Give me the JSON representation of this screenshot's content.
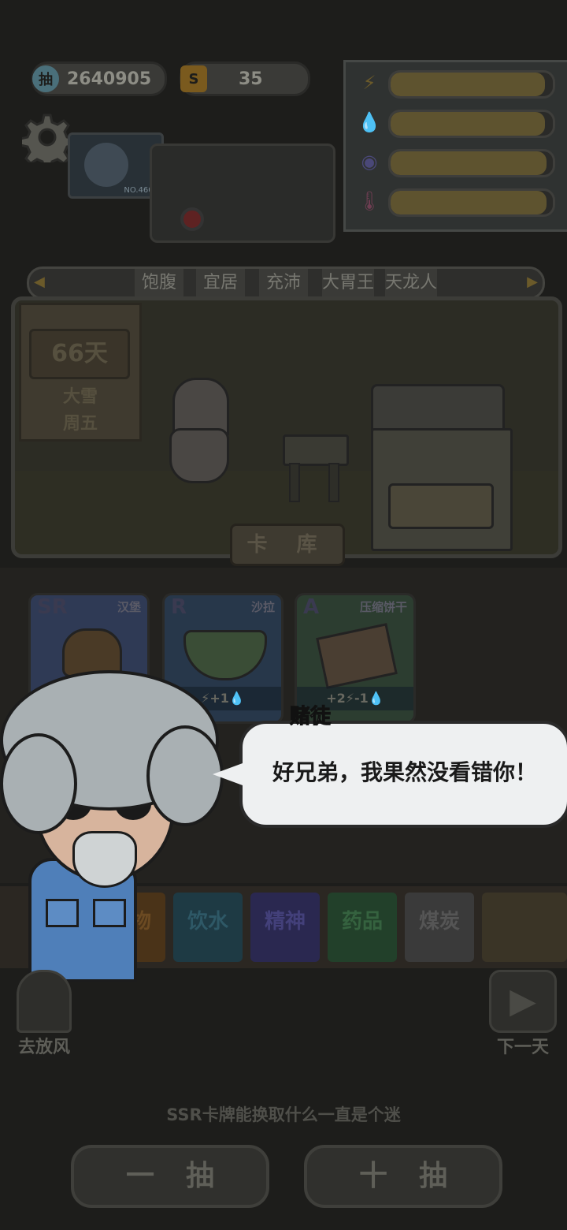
{
  "currencies": {
    "draws": {
      "icon": "抽",
      "value": "2640905"
    },
    "coins": {
      "icon": "S",
      "value": "35"
    }
  },
  "stats": [
    {
      "icon_name": "energy-icon",
      "level": 0.95
    },
    {
      "icon_name": "water-drop-icon",
      "level": 0.95
    },
    {
      "icon_name": "brain-icon",
      "level": 0.96
    },
    {
      "icon_name": "thermometer-icon",
      "level": 0.96
    }
  ],
  "avatar_label": "NO.4601",
  "tabs": [
    "饱腹",
    "宜居",
    "充沛",
    "大胃王",
    "天龙人"
  ],
  "day_board": {
    "day": "66天",
    "weather": "大雪",
    "weekday": "周五"
  },
  "card_library_label": "卡 库",
  "cards": [
    {
      "rank": "SR",
      "name": "汉堡",
      "stats": ""
    },
    {
      "rank": "R",
      "name": "沙拉",
      "stats": "⚡+1💧"
    },
    {
      "rank": "A",
      "name": "压缩饼干",
      "stats": "+2⚡-1💧"
    }
  ],
  "categories": [
    "食物",
    "饮水",
    "精神",
    "药品",
    "煤炭"
  ],
  "dialog": {
    "speaker": "赌徒",
    "text": "好兄弟，我果然没看错你！"
  },
  "side_buttons": {
    "left": "去放风",
    "right": "下一天"
  },
  "tip": "SSR卡牌能换取什么一直是个迷",
  "draw_buttons": {
    "single": "一抽",
    "ten": "十抽"
  },
  "colors": {
    "accent": "#6b5a2a",
    "bubble": "#eef0f1",
    "background": "#1d1d1b"
  }
}
